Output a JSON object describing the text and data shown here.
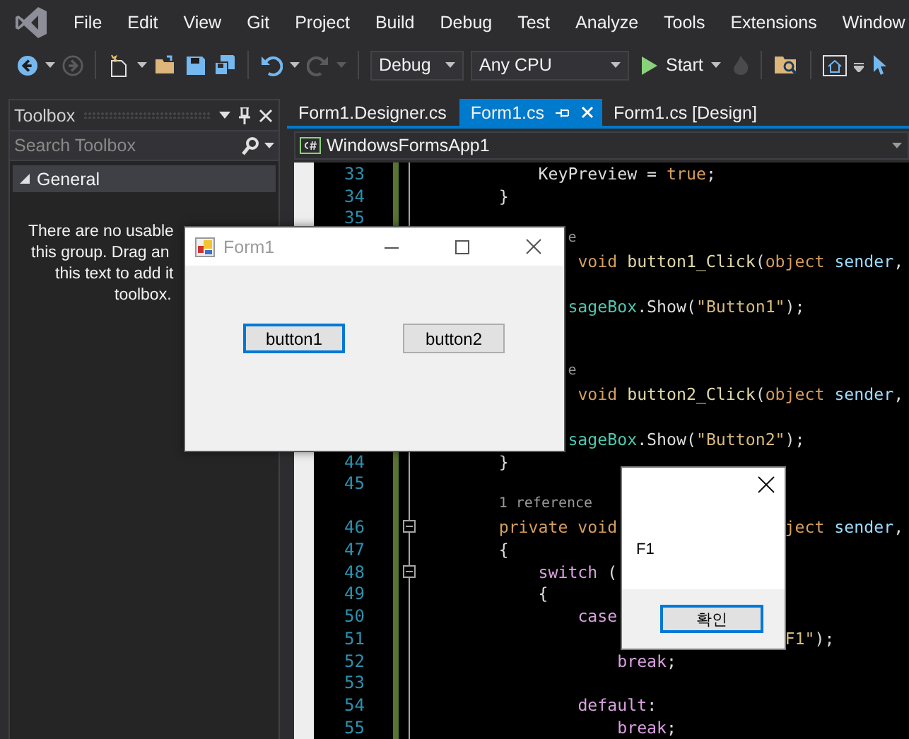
{
  "menu": [
    "File",
    "Edit",
    "View",
    "Git",
    "Project",
    "Build",
    "Debug",
    "Test",
    "Analyze",
    "Tools",
    "Extensions",
    "Window"
  ],
  "toolbar": {
    "configuration": "Debug",
    "platform": "Any CPU",
    "start": "Start"
  },
  "toolbox": {
    "title": "Toolbox",
    "search": {
      "placeholder": "Search Toolbox"
    },
    "groups": [
      {
        "label": "General",
        "expanded": true
      }
    ],
    "message": [
      "There are no usable",
      "this group. Drag an",
      "this text to add it",
      "toolbox."
    ]
  },
  "tabs": [
    {
      "label": "Form1.Designer.cs",
      "selected": false
    },
    {
      "label": "Form1.cs",
      "selected": true
    },
    {
      "label": "Form1.cs [Design]",
      "selected": false
    }
  ],
  "navigation": {
    "project": "WindowsFormsApp1"
  },
  "editor": {
    "rows": [
      {
        "kind": "code",
        "number": "33",
        "pieces": [
          {
            "tokens": [
              {
                "color": "#dcdcdc",
                "text": "            KeyPreview = "
              },
              {
                "color": "#d69d5c",
                "text": "true"
              },
              {
                "color": "#dcdcdc",
                "text": ";"
              }
            ]
          }
        ]
      },
      {
        "kind": "code",
        "number": "34",
        "pieces": [
          {
            "tokens": [
              {
                "color": "#dcdcdc",
                "text": "        }"
              }
            ]
          }
        ]
      },
      {
        "kind": "code",
        "number": "35",
        "pieces": []
      },
      {
        "kind": "lens",
        "pieces": [
          {
            "tokens": [
              {
                "color": "#999999",
                "text": "               e"
              }
            ]
          }
        ]
      },
      {
        "kind": "code",
        "pieces": [
          {
            "tokens": [
              {
                "color": "#d69d5c",
                "text": "                void"
              },
              {
                "color": "#e0d7a6",
                "text": " button1_Click"
              },
              {
                "color": "#dcdcdc",
                "text": "("
              },
              {
                "color": "#d69d5c",
                "text": "object"
              },
              {
                "color": "#9cdcfe",
                "text": " sender"
              },
              {
                "color": "#dcdcdc",
                "text": ","
              }
            ]
          }
        ]
      },
      {
        "kind": "code",
        "pieces": []
      },
      {
        "kind": "code",
        "pieces": [
          {
            "tokens": [
              {
                "color": "#4ec9b0",
                "text": "               sageBox"
              },
              {
                "color": "#dcdcdc",
                "text": ".Show("
              },
              {
                "color": "#d7ba7d",
                "text": "\"Button1\""
              },
              {
                "color": "#dcdcdc",
                "text": ");"
              }
            ]
          }
        ]
      },
      {
        "kind": "code",
        "pieces": []
      },
      {
        "kind": "code",
        "pieces": []
      },
      {
        "kind": "lens",
        "pieces": [
          {
            "tokens": [
              {
                "color": "#999999",
                "text": "               e"
              }
            ]
          }
        ]
      },
      {
        "kind": "code",
        "pieces": [
          {
            "tokens": [
              {
                "color": "#d69d5c",
                "text": "                void"
              },
              {
                "color": "#e0d7a6",
                "text": " button2_Click"
              },
              {
                "color": "#dcdcdc",
                "text": "("
              },
              {
                "color": "#d69d5c",
                "text": "object"
              },
              {
                "color": "#9cdcfe",
                "text": " sender"
              },
              {
                "color": "#dcdcdc",
                "text": ","
              }
            ]
          }
        ]
      },
      {
        "kind": "code",
        "pieces": []
      },
      {
        "kind": "code",
        "pieces": [
          {
            "tokens": [
              {
                "color": "#4ec9b0",
                "text": "               sageBox"
              },
              {
                "color": "#dcdcdc",
                "text": ".Show("
              },
              {
                "color": "#d7ba7d",
                "text": "\"Button2\""
              },
              {
                "color": "#dcdcdc",
                "text": ");"
              }
            ]
          }
        ]
      },
      {
        "kind": "code",
        "number": "44",
        "pieces": [
          {
            "tokens": [
              {
                "color": "#dcdcdc",
                "text": "        }"
              }
            ]
          }
        ]
      },
      {
        "kind": "code",
        "number": "45",
        "pieces": []
      },
      {
        "kind": "lens",
        "pieces": [
          {
            "tokens": [
              {
                "color": "#999999",
                "text": "        1 reference"
              }
            ]
          }
        ]
      },
      {
        "kind": "code",
        "number": "46",
        "fold": true,
        "pieces": [
          {
            "tokens": [
              {
                "color": "#d69d5c",
                "text": "        private void"
              }
            ]
          },
          {
            "tokens": [
              {
                "color": "#d69d5c",
                "text": "                 ject"
              },
              {
                "color": "#9cdcfe",
                "text": " sender"
              },
              {
                "color": "#dcdcdc",
                "text": ","
              }
            ]
          }
        ]
      },
      {
        "kind": "code",
        "number": "47",
        "pieces": [
          {
            "tokens": [
              {
                "color": "#dcdcdc",
                "text": "        {"
              }
            ]
          }
        ]
      },
      {
        "kind": "code",
        "number": "48",
        "fold": true,
        "pieces": [
          {
            "tokens": [
              {
                "color": "#d8a0df",
                "text": "            switch"
              },
              {
                "color": "#dcdcdc",
                "text": " ("
              }
            ]
          }
        ]
      },
      {
        "kind": "code",
        "number": "49",
        "pieces": [
          {
            "tokens": [
              {
                "color": "#dcdcdc",
                "text": "            {"
              }
            ]
          }
        ]
      },
      {
        "kind": "code",
        "number": "50",
        "pieces": [
          {
            "tokens": [
              {
                "color": "#d8a0df",
                "text": "                case"
              }
            ]
          }
        ]
      },
      {
        "kind": "code",
        "number": "51",
        "pieces": [
          {
            "tokens": [
              {
                "color": "#d7ba7d",
                "text": "                                     F1\""
              },
              {
                "color": "#dcdcdc",
                "text": ");"
              }
            ]
          }
        ]
      },
      {
        "kind": "code",
        "number": "52",
        "pieces": [
          {
            "tokens": [
              {
                "color": "#d8a0df",
                "text": "                    break"
              },
              {
                "color": "#dcdcdc",
                "text": ";"
              }
            ]
          }
        ]
      },
      {
        "kind": "code",
        "number": "53",
        "pieces": []
      },
      {
        "kind": "code",
        "number": "54",
        "pieces": [
          {
            "tokens": [
              {
                "color": "#d8a0df",
                "text": "                default"
              },
              {
                "color": "#dcdcdc",
                "text": ":"
              }
            ]
          }
        ]
      },
      {
        "kind": "code",
        "number": "55",
        "pieces": [
          {
            "tokens": [
              {
                "color": "#d8a0df",
                "text": "                    break"
              },
              {
                "color": "#dcdcdc",
                "text": ";"
              }
            ]
          }
        ]
      }
    ]
  },
  "form_window": {
    "title": "Form1",
    "buttons": [
      {
        "label": "button1",
        "focused": true
      },
      {
        "label": "button2",
        "focused": false
      }
    ]
  },
  "message_box": {
    "text": "F1",
    "button": "확인"
  }
}
